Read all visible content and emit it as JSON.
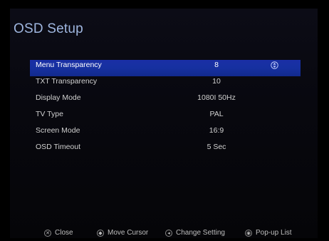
{
  "title": "OSD Setup",
  "menu": [
    {
      "label": "Menu Transparency",
      "value": "8",
      "selected": true
    },
    {
      "label": "TXT Transparency",
      "value": "10"
    },
    {
      "label": "Display Mode",
      "value": "1080I 50Hz"
    },
    {
      "label": "TV Type",
      "value": "PAL"
    },
    {
      "label": "Screen Mode",
      "value": "16:9"
    },
    {
      "label": "OSD Timeout",
      "value": "5 Sec"
    }
  ],
  "footer": [
    {
      "label": "Close",
      "icon": "exit-icon"
    },
    {
      "label": "Move Cursor",
      "icon": "move-cursor-icon"
    },
    {
      "label": "Change Setting",
      "icon": "change-setting-icon"
    },
    {
      "label": "Pop-up List",
      "icon": "popup-list-icon"
    }
  ],
  "colors": {
    "accent": "#1a2fa6",
    "title": "#9fb6df",
    "background": "#000000"
  }
}
